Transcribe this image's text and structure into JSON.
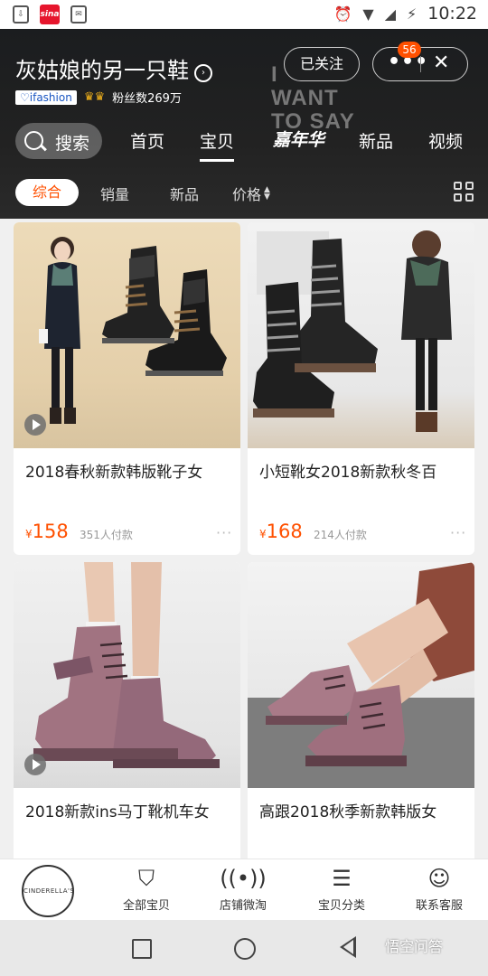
{
  "status_bar": {
    "time": "10:22",
    "left_icons": [
      "download-box-icon",
      "sina-weibo-icon",
      "message-icon"
    ],
    "right_icons": [
      "alarm-icon",
      "wifi-icon",
      "signal-icon",
      "battery-charging-icon"
    ],
    "sina_label": "sina"
  },
  "header": {
    "shop_name": "灰姑娘的另一只鞋",
    "platform_tag": "ifashion",
    "followers": "粉丝数269万",
    "follow_label": "已关注",
    "notification_count": "56",
    "decor_text": [
      "I",
      "WANT",
      "TO SAY"
    ],
    "background_color": "#1b1d1f",
    "accent_color": "#ff5000"
  },
  "nav": {
    "search_label": "搜索",
    "tabs": [
      {
        "label": "首页"
      },
      {
        "label": "宝贝",
        "active": true
      },
      {
        "label": "嘉年华"
      },
      {
        "label": "新品"
      },
      {
        "label": "视频"
      }
    ]
  },
  "sort": {
    "options": [
      {
        "label": "综合",
        "active": true
      },
      {
        "label": "销量"
      },
      {
        "label": "新品"
      },
      {
        "label": "价格"
      }
    ]
  },
  "products": [
    {
      "title": "2018春秋新款韩版靴子女",
      "currency": "¥",
      "price": "158",
      "sold": "351人付款",
      "has_video": true
    },
    {
      "title": "小短靴女2018新款秋冬百",
      "currency": "¥",
      "price": "168",
      "sold": "214人付款",
      "has_video": false
    },
    {
      "title": "2018新款ins马丁靴机车女",
      "has_video": true
    },
    {
      "title": "高跟2018秋季新款韩版女",
      "has_video": false
    }
  ],
  "shop_nav": {
    "logo_text": "CINDERELLA'S",
    "items": [
      {
        "label": "全部宝贝",
        "icon": "shopping-bag-icon"
      },
      {
        "label": "店铺微淘",
        "icon": "broadcast-icon"
      },
      {
        "label": "宝贝分类",
        "icon": "list-icon"
      },
      {
        "label": "联系客服",
        "icon": "customer-service-icon"
      }
    ]
  },
  "watermark": "悟空问答"
}
